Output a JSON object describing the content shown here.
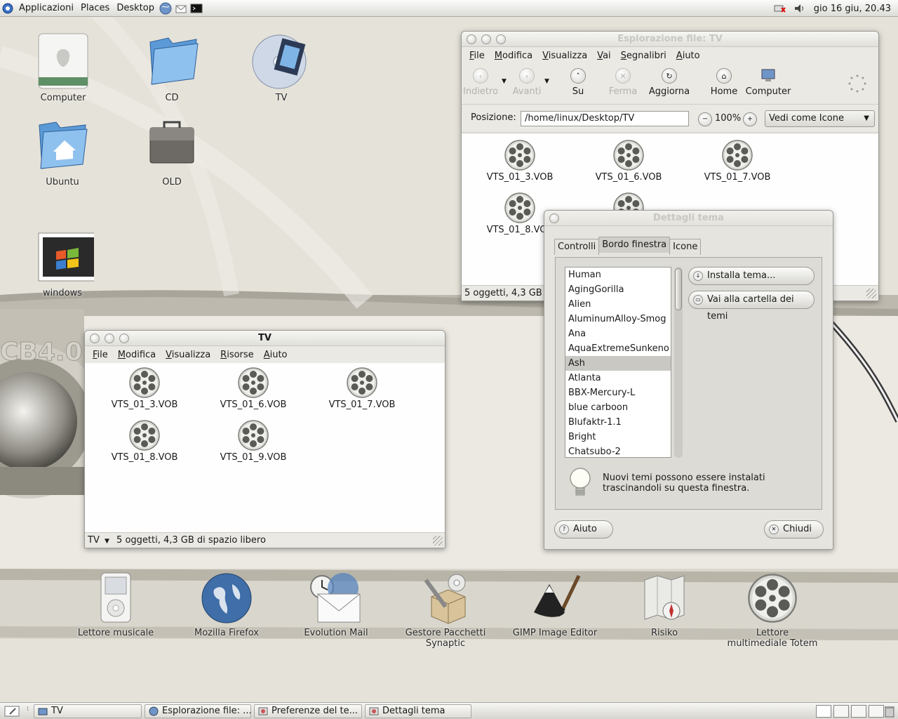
{
  "top_panel": {
    "menus": [
      "Applicazioni",
      "Places",
      "Desktop"
    ],
    "clock": "gio 16 giu, 20.43"
  },
  "desktop_icons": [
    {
      "label": "Computer",
      "icon": "hard-drive-icon"
    },
    {
      "label": "CD",
      "icon": "blue-folder-icon"
    },
    {
      "label": "TV",
      "icon": "video-disc-icon"
    },
    {
      "label": "Ubuntu",
      "icon": "home-folder-icon"
    },
    {
      "label": "OLD",
      "icon": "briefcase-icon"
    },
    {
      "label": "windows",
      "icon": "windows-shortcut-icon"
    }
  ],
  "browser_window": {
    "title": "Esplorazione file: TV",
    "menu": [
      "File",
      "Modifica",
      "Visualizza",
      "Vai",
      "Segnalibri",
      "Aiuto"
    ],
    "toolbar": {
      "back": "Indietro",
      "forward": "Avanti",
      "up": "Su",
      "stop": "Ferma",
      "reload": "Aggiorna",
      "home": "Home",
      "computer": "Computer"
    },
    "location_label": "Posizione:",
    "location_value": "/home/linux/Desktop/TV",
    "zoom": "100%",
    "view_mode": "Vedi come Icone",
    "files": [
      "VTS_01_3.VOB",
      "VTS_01_6.VOB",
      "VTS_01_7.VOB",
      "VTS_01_8.VOB"
    ],
    "status": "5 oggetti, 4,3 GB di spazio libero"
  },
  "tv_window": {
    "title": "TV",
    "menu": [
      "File",
      "Modifica",
      "Visualizza",
      "Risorse",
      "Aiuto"
    ],
    "files": [
      "VTS_01_3.VOB",
      "VTS_01_6.VOB",
      "VTS_01_7.VOB",
      "VTS_01_8.VOB",
      "VTS_01_9.VOB"
    ],
    "status_location": "TV",
    "status": "5 oggetti, 4,3 GB di spazio libero"
  },
  "theme_dialog": {
    "title": "Dettagli tema",
    "tabs": [
      "Controlli",
      "Bordo finestra",
      "Icone"
    ],
    "themes": [
      "Human",
      "AgingGorilla",
      "Alien",
      "AluminumAlloy-Smog",
      "Ana",
      "AquaExtremeSunkeno",
      "Ash",
      "Atlanta",
      "BBX-Mercury-L",
      "blue carboon",
      "Blufaktr-1.1",
      "Bright",
      "Chatsubo-2"
    ],
    "selected_theme": "Ash",
    "install_button": "Installa tema...",
    "folder_button": "Vai alla cartella dei temi",
    "hint_line1": "Nuovi temi possono essere instalati",
    "hint_line2": "trascinandoli su questa finestra.",
    "help_button": "Aiuto",
    "close_button": "Chiudi"
  },
  "dock": [
    {
      "label": "Lettore musicale",
      "icon": "ipod-icon"
    },
    {
      "label": "Mozilla Firefox",
      "icon": "globe-icon"
    },
    {
      "label": "Evolution Mail",
      "icon": "mail-clock-icon"
    },
    {
      "label": "Gestore Pacchetti Synaptic",
      "icon": "package-tools-icon"
    },
    {
      "label": "GIMP Image Editor",
      "icon": "gimp-icon"
    },
    {
      "label": "Risiko",
      "icon": "map-compass-icon"
    },
    {
      "label": "Lettore multimediale Totem",
      "icon": "film-reel-icon"
    }
  ],
  "taskbar": [
    "TV",
    "Esplorazione file: ...",
    "Preferenze del te...",
    "Dettagli tema"
  ],
  "colors": {
    "desktop": "#e4e1d8",
    "band": "#b9b5a9",
    "panel": "#e6e5e1"
  }
}
